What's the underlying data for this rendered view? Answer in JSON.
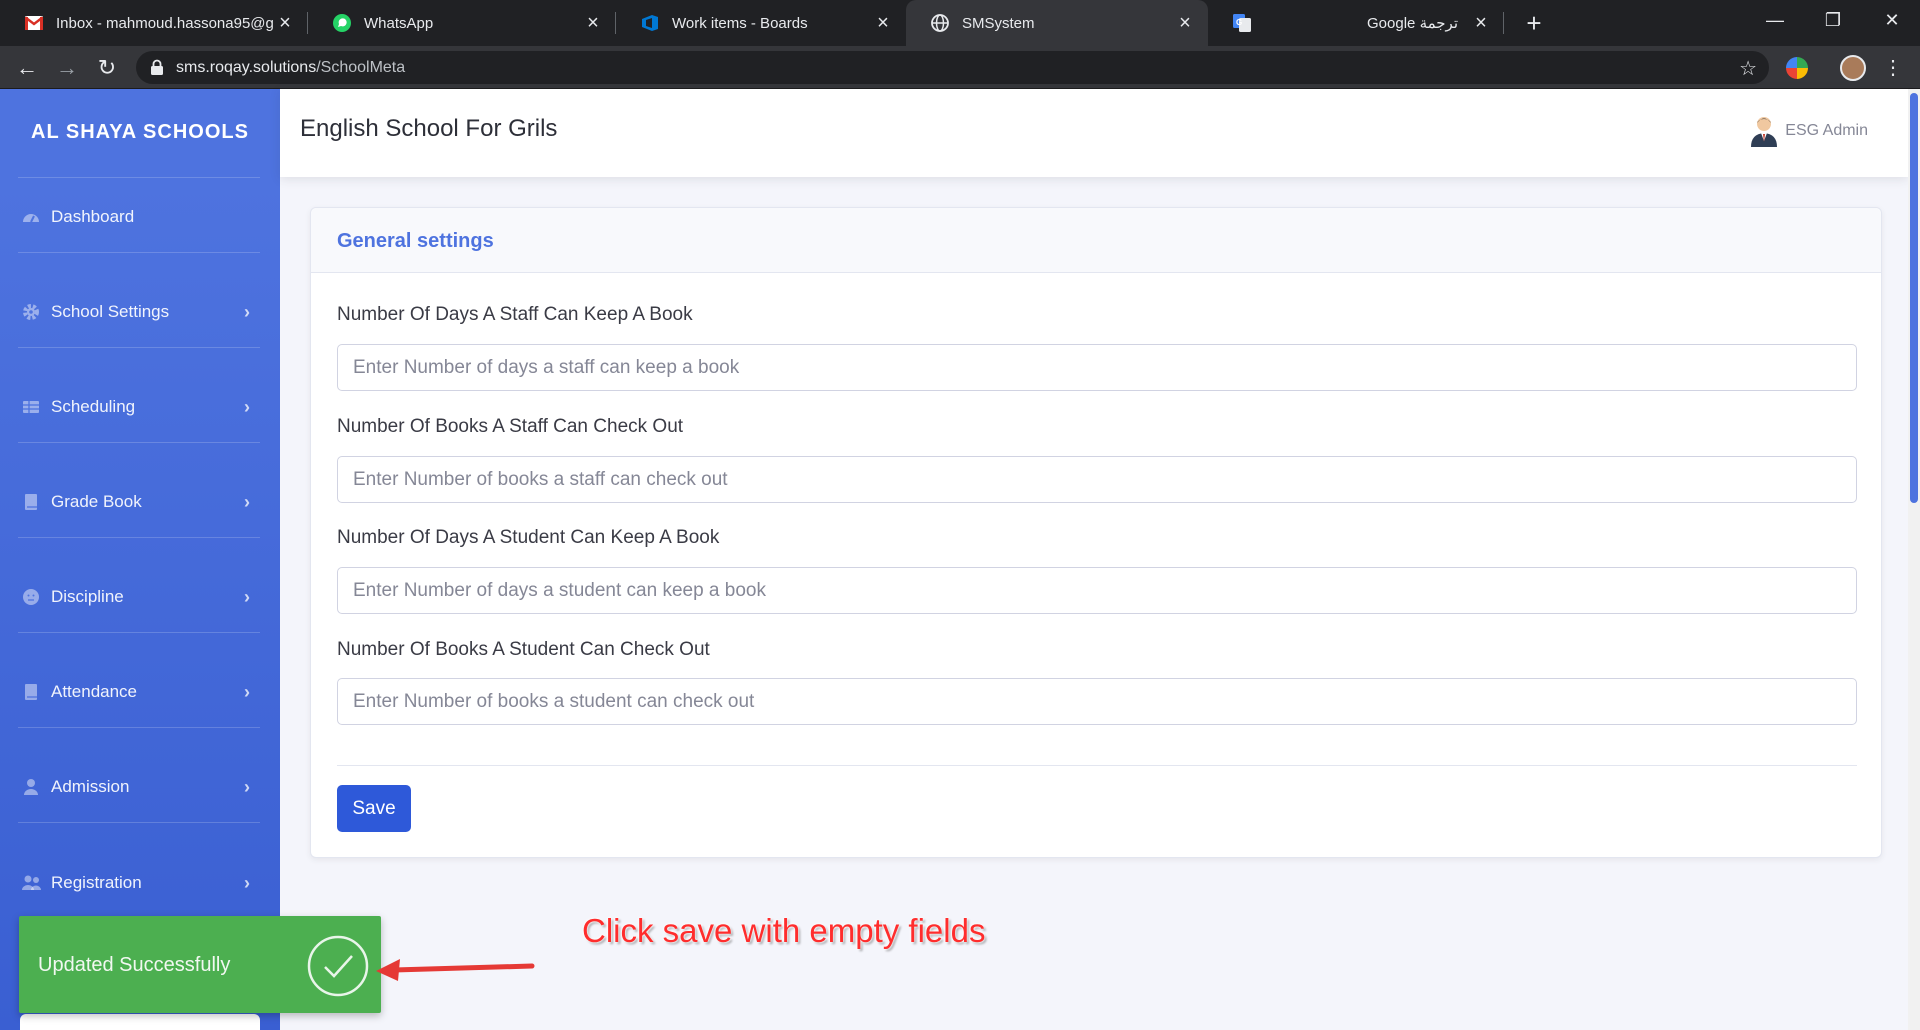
{
  "browser": {
    "tabs": [
      {
        "title": "Inbox - mahmoud.hassona95@g",
        "icon": "gmail-icon",
        "active": false
      },
      {
        "title": "WhatsApp",
        "icon": "whatsapp-icon",
        "active": false
      },
      {
        "title": "Work items - Boards",
        "icon": "azure-devops-icon",
        "active": false
      },
      {
        "title": "SMSystem",
        "icon": "globe-icon",
        "active": true
      },
      {
        "title": "Google ترجمة",
        "icon": "google-translate-icon",
        "active": false
      }
    ],
    "url_host": "sms.roqay.solutions",
    "url_path": "/SchoolMeta"
  },
  "sidebar": {
    "brand": "AL SHAYA SCHOOLS",
    "items": [
      {
        "label": "Dashboard",
        "icon": "dashboard-icon",
        "has_children": false
      },
      {
        "label": "School Settings",
        "icon": "gear-icon",
        "has_children": true
      },
      {
        "label": "Scheduling",
        "icon": "table-icon",
        "has_children": true
      },
      {
        "label": "Grade Book",
        "icon": "book-icon",
        "has_children": true
      },
      {
        "label": "Discipline",
        "icon": "smiley-icon",
        "has_children": true
      },
      {
        "label": "Attendance",
        "icon": "book-icon",
        "has_children": true
      },
      {
        "label": "Admission",
        "icon": "user-icon",
        "has_children": true
      },
      {
        "label": "Registration",
        "icon": "users-icon",
        "has_children": true
      }
    ]
  },
  "topbar": {
    "title": "English School For Grils",
    "user_name": "ESG Admin"
  },
  "card": {
    "title": "General settings",
    "fields": [
      {
        "label": "Number Of Days A Staff Can Keep A Book",
        "placeholder": "Enter Number of days a staff can keep a book",
        "value": ""
      },
      {
        "label": "Number Of Books A Staff Can Check Out",
        "placeholder": "Enter Number of books a staff can check out",
        "value": ""
      },
      {
        "label": "Number Of Days A Student Can Keep A Book",
        "placeholder": "Enter Number of days a student can keep a book",
        "value": ""
      },
      {
        "label": "Number Of Books A Student Can Check Out",
        "placeholder": "Enter Number of books a student can check out",
        "value": ""
      }
    ],
    "save_label": "Save"
  },
  "toast": {
    "message": "Updated Successfully",
    "color": "#4caf50"
  },
  "annotation": {
    "text": "Click save with empty fields",
    "color": "#ff2d2d"
  },
  "colors": {
    "primary": "#4e73df",
    "sidebar_bottom": "#3a5fd2"
  }
}
